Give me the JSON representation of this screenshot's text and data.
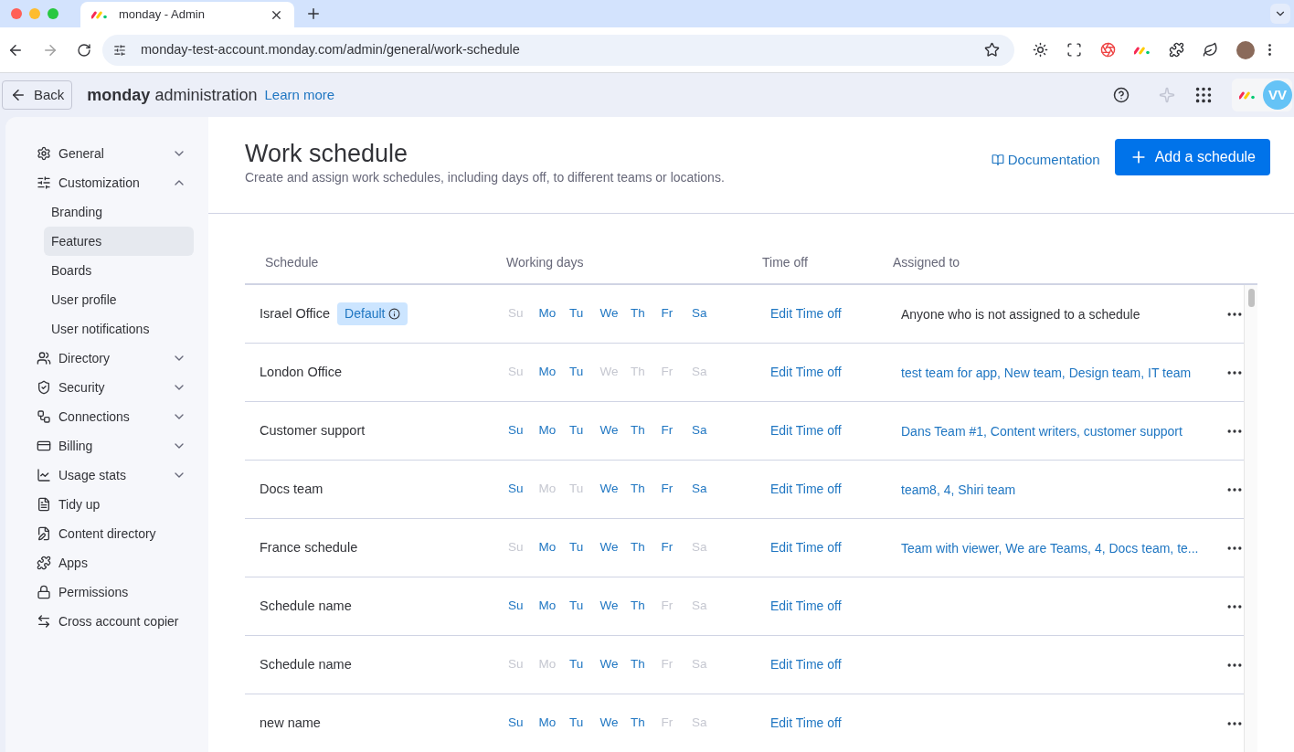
{
  "browser": {
    "tab_title": "monday - Admin",
    "url": "monday-test-account.monday.com/admin/general/work-schedule"
  },
  "header": {
    "brand_bold": "monday",
    "brand_rest": "administration",
    "back": "Back",
    "learn_more": "Learn more",
    "avatar": "VV"
  },
  "sidebar": {
    "items": [
      {
        "label": "General",
        "kind": "group",
        "expanded": false,
        "selected": false
      },
      {
        "label": "Customization",
        "kind": "group",
        "expanded": true,
        "selected": false,
        "children": [
          {
            "label": "Branding",
            "selected": false
          },
          {
            "label": "Features",
            "selected": true
          },
          {
            "label": "Boards",
            "selected": false
          },
          {
            "label": "User profile",
            "selected": false
          },
          {
            "label": "User notifications",
            "selected": false
          }
        ]
      },
      {
        "label": "Directory",
        "kind": "group",
        "expanded": false,
        "selected": false
      },
      {
        "label": "Security",
        "kind": "group",
        "expanded": false,
        "selected": false
      },
      {
        "label": "Connections",
        "kind": "group",
        "expanded": false,
        "selected": false
      },
      {
        "label": "Billing",
        "kind": "group",
        "expanded": false,
        "selected": false
      },
      {
        "label": "Usage stats",
        "kind": "group",
        "expanded": false,
        "selected": false
      },
      {
        "label": "Tidy up",
        "kind": "link",
        "selected": false
      },
      {
        "label": "Content directory",
        "kind": "link",
        "selected": false
      },
      {
        "label": "Apps",
        "kind": "link",
        "selected": false
      },
      {
        "label": "Permissions",
        "kind": "link",
        "selected": false
      },
      {
        "label": "Cross account copier",
        "kind": "link",
        "selected": false
      }
    ]
  },
  "page": {
    "title": "Work schedule",
    "subtitle": "Create and assign work schedules, including days off, to different teams or locations.",
    "documentation": "Documentation",
    "add_button": "Add a schedule"
  },
  "table": {
    "columns": [
      "Schedule",
      "Working days",
      "Time off",
      "Assigned to"
    ],
    "rows": [
      {
        "name": "Israel Office",
        "badge": "Default",
        "days": [
          {
            "label": "Su",
            "on": false
          },
          {
            "label": "Mo",
            "on": true
          },
          {
            "label": "Tu",
            "on": true
          },
          {
            "label": "We",
            "on": true
          },
          {
            "label": "Th",
            "on": true
          },
          {
            "label": "Fr",
            "on": true
          },
          {
            "label": "Sa",
            "on": true
          }
        ],
        "time_off": "Edit Time off",
        "assigned": {
          "text": "Anyone who is not assigned to a schedule",
          "kind": "note"
        }
      },
      {
        "name": "London Office",
        "days": [
          {
            "label": "Su",
            "on": false
          },
          {
            "label": "Mo",
            "on": true
          },
          {
            "label": "Tu",
            "on": true
          },
          {
            "label": "We",
            "on": false
          },
          {
            "label": "Th",
            "on": false
          },
          {
            "label": "Fr",
            "on": false
          },
          {
            "label": "Sa",
            "on": false
          }
        ],
        "time_off": "Edit Time off",
        "assigned": {
          "text": "test team for app, New team, Design team, IT team",
          "kind": "teams"
        }
      },
      {
        "name": "Customer support",
        "days": [
          {
            "label": "Su",
            "on": true
          },
          {
            "label": "Mo",
            "on": true
          },
          {
            "label": "Tu",
            "on": true
          },
          {
            "label": "We",
            "on": true
          },
          {
            "label": "Th",
            "on": true
          },
          {
            "label": "Fr",
            "on": true
          },
          {
            "label": "Sa",
            "on": true
          }
        ],
        "time_off": "Edit Time off",
        "assigned": {
          "text": "Dans Team #1, Content writers, customer support",
          "kind": "teams"
        }
      },
      {
        "name": "Docs team",
        "days": [
          {
            "label": "Su",
            "on": true
          },
          {
            "label": "Mo",
            "on": false
          },
          {
            "label": "Tu",
            "on": false
          },
          {
            "label": "We",
            "on": true
          },
          {
            "label": "Th",
            "on": true
          },
          {
            "label": "Fr",
            "on": true
          },
          {
            "label": "Sa",
            "on": true
          }
        ],
        "time_off": "Edit Time off",
        "assigned": {
          "text": "team8, 4, Shiri team",
          "kind": "teams"
        }
      },
      {
        "name": "France schedule",
        "days": [
          {
            "label": "Su",
            "on": false
          },
          {
            "label": "Mo",
            "on": true
          },
          {
            "label": "Tu",
            "on": true
          },
          {
            "label": "We",
            "on": true
          },
          {
            "label": "Th",
            "on": true
          },
          {
            "label": "Fr",
            "on": true
          },
          {
            "label": "Sa",
            "on": false
          }
        ],
        "time_off": "Edit Time off",
        "assigned": {
          "text": "Team with viewer, We are Teams, 4, Docs team, te...",
          "kind": "teams"
        }
      },
      {
        "name": "Schedule name",
        "days": [
          {
            "label": "Su",
            "on": true
          },
          {
            "label": "Mo",
            "on": true
          },
          {
            "label": "Tu",
            "on": true
          },
          {
            "label": "We",
            "on": true
          },
          {
            "label": "Th",
            "on": true
          },
          {
            "label": "Fr",
            "on": false
          },
          {
            "label": "Sa",
            "on": false
          }
        ],
        "time_off": "Edit Time off"
      },
      {
        "name": "Schedule name",
        "days": [
          {
            "label": "Su",
            "on": false
          },
          {
            "label": "Mo",
            "on": false
          },
          {
            "label": "Tu",
            "on": true
          },
          {
            "label": "We",
            "on": true
          },
          {
            "label": "Th",
            "on": true
          },
          {
            "label": "Fr",
            "on": false
          },
          {
            "label": "Sa",
            "on": false
          }
        ],
        "time_off": "Edit Time off"
      },
      {
        "name": "new name",
        "days": [
          {
            "label": "Su",
            "on": true
          },
          {
            "label": "Mo",
            "on": true
          },
          {
            "label": "Tu",
            "on": true
          },
          {
            "label": "We",
            "on": true
          },
          {
            "label": "Th",
            "on": true
          },
          {
            "label": "Fr",
            "on": false
          },
          {
            "label": "Sa",
            "on": false
          }
        ],
        "time_off": "Edit Time off"
      }
    ]
  }
}
